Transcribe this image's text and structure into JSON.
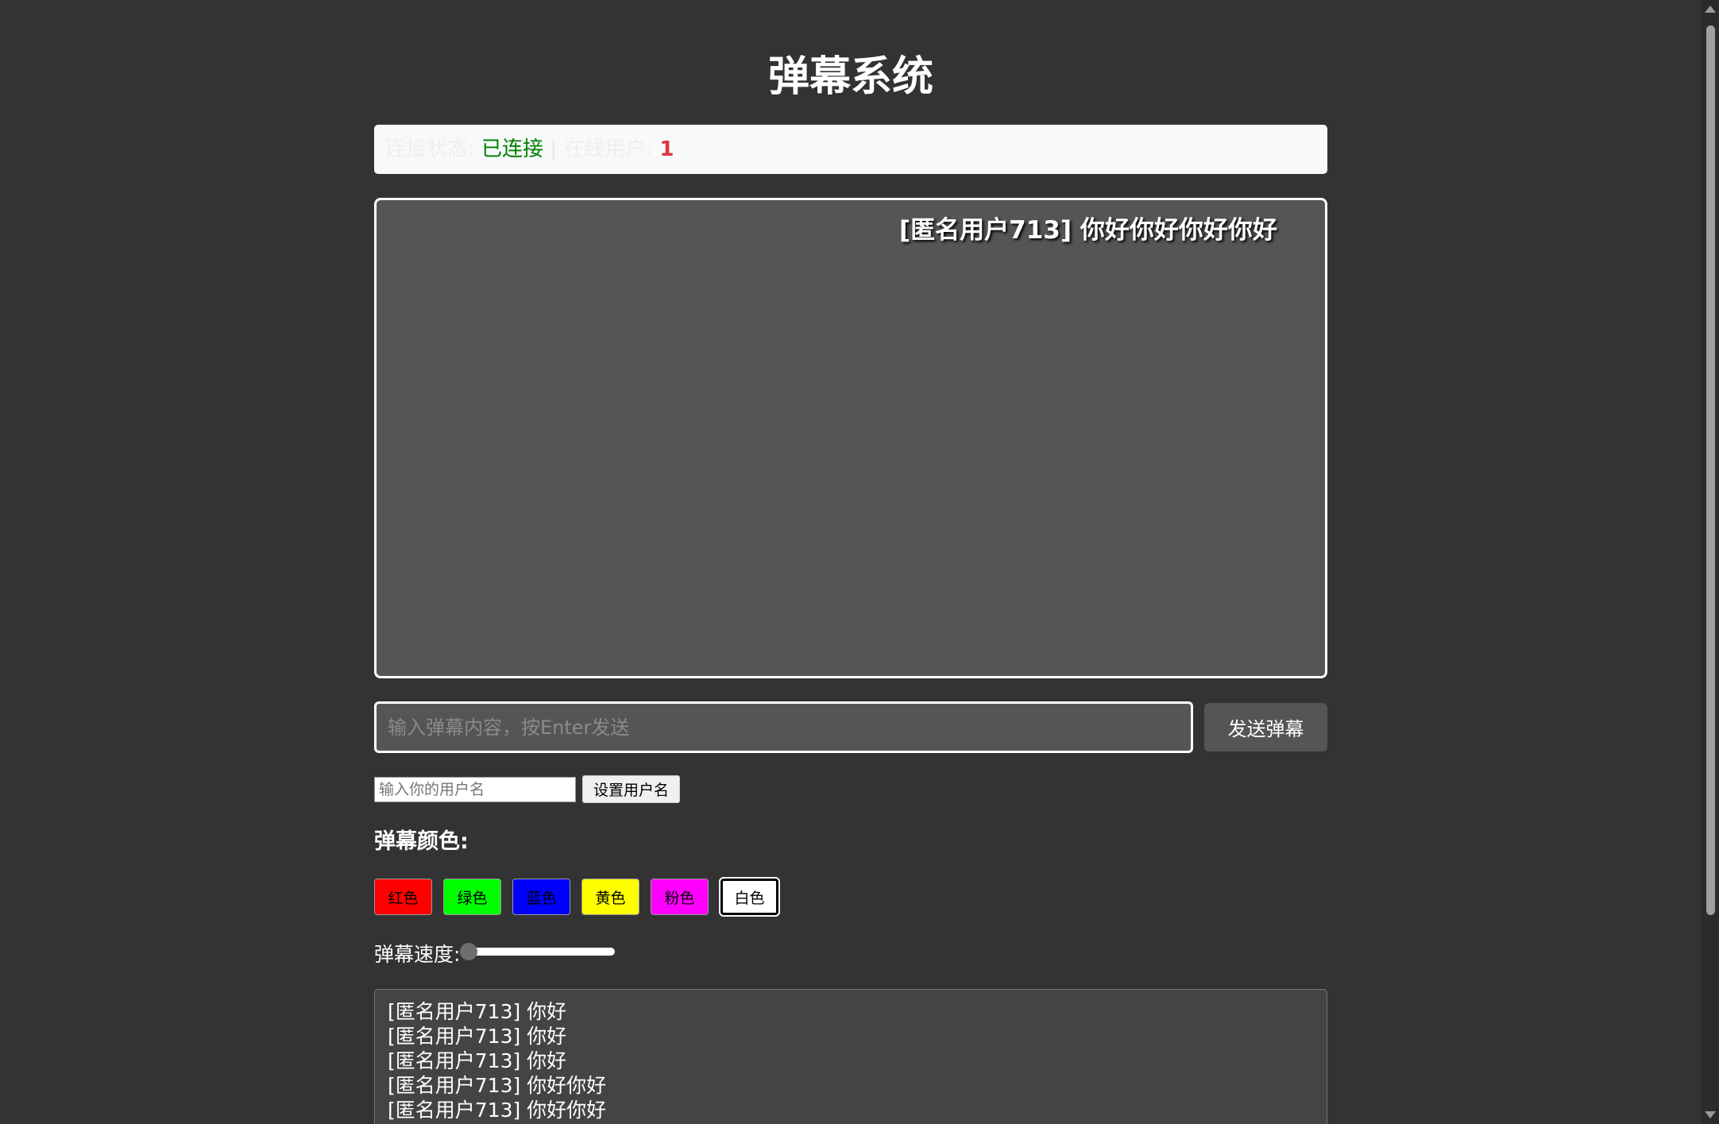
{
  "page": {
    "title": "弹幕系统"
  },
  "status": {
    "connection_label": "连接状态:",
    "connection_value": "已连接",
    "separator": "|",
    "online_label": "在线用户:",
    "online_count": "1"
  },
  "stage": {
    "active_danmaku": {
      "text": "[匿名用户713] 你好你好你好你好",
      "color": "#ffffff"
    }
  },
  "composer": {
    "message_placeholder": "输入弹幕内容，按Enter发送",
    "message_value": "",
    "send_label": "发送弹幕"
  },
  "username": {
    "placeholder": "输入你的用户名",
    "value": "",
    "set_label": "设置用户名"
  },
  "colors": {
    "label": "弹幕颜色:",
    "options": [
      {
        "label": "红色",
        "color": "#ff0000",
        "selected": false
      },
      {
        "label": "绿色",
        "color": "#00ff00",
        "selected": false
      },
      {
        "label": "蓝色",
        "color": "#0000ff",
        "selected": false
      },
      {
        "label": "黄色",
        "color": "#ffff00",
        "selected": false
      },
      {
        "label": "粉色",
        "color": "#ff00ff",
        "selected": false
      },
      {
        "label": "白色",
        "color": "#ffffff",
        "selected": true
      }
    ]
  },
  "speed": {
    "label": "弹幕速度:",
    "value_fraction": 0.0
  },
  "history": [
    "[匿名用户713] 你好",
    "[匿名用户713] 你好",
    "[匿名用户713] 你好",
    "[匿名用户713] 你好你好",
    "[匿名用户713] 你好你好"
  ]
}
